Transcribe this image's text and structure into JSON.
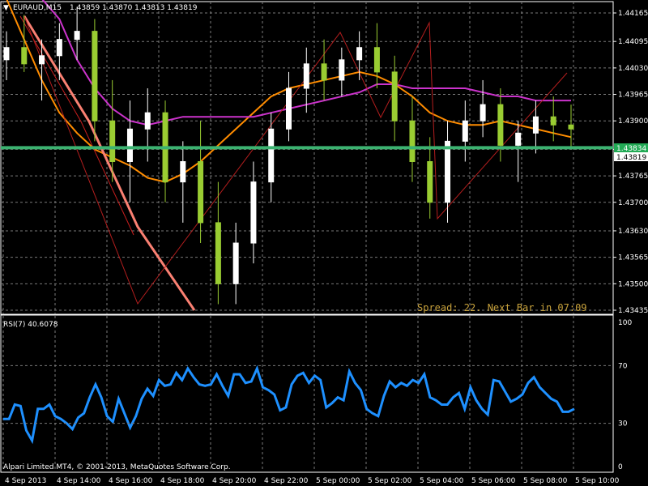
{
  "header": {
    "symbol": "EURAUD,M15",
    "ohlc": "1.43859 1.43870 1.43813 1.43819"
  },
  "spread_text": "Spread: 22. Next Bar in 07:09",
  "price_tags": {
    "bid": "1.43834",
    "last": "1.43819"
  },
  "copyright": "Alpari Limited MT4, © 2001-2013, MetaQuotes Software Corp.",
  "colors": {
    "bull": "#ffffff",
    "bear": "#9acd32",
    "bull_body": "#ffffff",
    "bear_body": "#9acd32",
    "grid": "#7a7a7a",
    "rsi": "#1e90ff",
    "ma_orange": "#ff8c00",
    "ma_magenta": "#cc33cc",
    "ma_salmon": "#fa8072",
    "ma_red": "#c81e1e",
    "zigzag": "#b41e1e",
    "spread_text": "#c8a23c",
    "hline": "#3cb371",
    "tag_bg": "#22aa55"
  },
  "chart_data": [
    {
      "type": "candlestick",
      "title": "EURAUD,M15",
      "ylim": [
        1.43435,
        1.44165
      ],
      "y_ticks": [
        "1.44165",
        "1.44095",
        "1.44030",
        "1.43965",
        "1.43900",
        "1.43830",
        "1.43765",
        "1.43700",
        "1.43630",
        "1.43565",
        "1.43500",
        "1.43435"
      ],
      "x_ticks": [
        "4 Sep 2013",
        "4 Sep 14:00",
        "4 Sep 16:00",
        "4 Sep 18:00",
        "4 Sep 20:00",
        "4 Sep 22:00",
        "5 Sep 00:00",
        "5 Sep 02:00",
        "5 Sep 04:00",
        "5 Sep 06:00",
        "5 Sep 08:00",
        "5 Sep 10:00"
      ],
      "horizontal_line": 1.43834,
      "candles": [
        {
          "o": 1.4405,
          "h": 1.4412,
          "l": 1.44,
          "c": 1.4408
        },
        {
          "o": 1.4408,
          "h": 1.4416,
          "l": 1.4402,
          "c": 1.4404
        },
        {
          "o": 1.4404,
          "h": 1.441,
          "l": 1.4395,
          "c": 1.4406
        },
        {
          "o": 1.4406,
          "h": 1.4414,
          "l": 1.44,
          "c": 1.441
        },
        {
          "o": 1.441,
          "h": 1.4418,
          "l": 1.4405,
          "c": 1.4412
        },
        {
          "o": 1.4412,
          "h": 1.4415,
          "l": 1.4385,
          "c": 1.439
        },
        {
          "o": 1.439,
          "h": 1.44,
          "l": 1.4375,
          "c": 1.438
        },
        {
          "o": 1.438,
          "h": 1.4395,
          "l": 1.437,
          "c": 1.4388
        },
        {
          "o": 1.4388,
          "h": 1.4398,
          "l": 1.438,
          "c": 1.4392
        },
        {
          "o": 1.4392,
          "h": 1.4395,
          "l": 1.437,
          "c": 1.4375
        },
        {
          "o": 1.4375,
          "h": 1.4385,
          "l": 1.4365,
          "c": 1.438
        },
        {
          "o": 1.438,
          "h": 1.439,
          "l": 1.436,
          "c": 1.4365
        },
        {
          "o": 1.4365,
          "h": 1.4375,
          "l": 1.4345,
          "c": 1.435
        },
        {
          "o": 1.435,
          "h": 1.4365,
          "l": 1.4345,
          "c": 1.436
        },
        {
          "o": 1.436,
          "h": 1.438,
          "l": 1.4355,
          "c": 1.4375
        },
        {
          "o": 1.4375,
          "h": 1.4392,
          "l": 1.437,
          "c": 1.4388
        },
        {
          "o": 1.4388,
          "h": 1.4402,
          "l": 1.4385,
          "c": 1.4398
        },
        {
          "o": 1.4398,
          "h": 1.4408,
          "l": 1.4392,
          "c": 1.4404
        },
        {
          "o": 1.4404,
          "h": 1.441,
          "l": 1.4395,
          "c": 1.44
        },
        {
          "o": 1.44,
          "h": 1.4408,
          "l": 1.4396,
          "c": 1.4405
        },
        {
          "o": 1.4405,
          "h": 1.4412,
          "l": 1.44,
          "c": 1.4408
        },
        {
          "o": 1.4408,
          "h": 1.4414,
          "l": 1.4398,
          "c": 1.4402
        },
        {
          "o": 1.4402,
          "h": 1.4406,
          "l": 1.4385,
          "c": 1.439
        },
        {
          "o": 1.439,
          "h": 1.4396,
          "l": 1.4375,
          "c": 1.438
        },
        {
          "o": 1.438,
          "h": 1.4386,
          "l": 1.4366,
          "c": 1.437
        },
        {
          "o": 1.437,
          "h": 1.439,
          "l": 1.4365,
          "c": 1.4385
        },
        {
          "o": 1.4385,
          "h": 1.4395,
          "l": 1.438,
          "c": 1.439
        },
        {
          "o": 1.439,
          "h": 1.44,
          "l": 1.4386,
          "c": 1.4394
        },
        {
          "o": 1.4394,
          "h": 1.4398,
          "l": 1.438,
          "c": 1.4384
        },
        {
          "o": 1.4384,
          "h": 1.439,
          "l": 1.4375,
          "c": 1.4387
        },
        {
          "o": 1.4387,
          "h": 1.4395,
          "l": 1.4382,
          "c": 1.4391
        },
        {
          "o": 1.4391,
          "h": 1.4396,
          "l": 1.4385,
          "c": 1.4389
        },
        {
          "o": 1.4389,
          "h": 1.4394,
          "l": 1.4383,
          "c": 1.4388
        }
      ],
      "series": [
        {
          "name": "MA orange",
          "values": [
            1.442,
            1.441,
            1.44,
            1.4392,
            1.4387,
            1.4383,
            1.4381,
            1.4379,
            1.4376,
            1.4375,
            1.4377,
            1.438,
            1.4384,
            1.4388,
            1.4392,
            1.4396,
            1.4398,
            1.4399,
            1.44,
            1.4401,
            1.4402,
            1.4401,
            1.4399,
            1.4396,
            1.4392,
            1.439,
            1.4389,
            1.4389,
            1.439,
            1.4389,
            1.4388,
            1.4387,
            1.4386
          ]
        },
        {
          "name": "MA magenta",
          "values": [
            1.443,
            1.4425,
            1.442,
            1.4415,
            1.4405,
            1.4398,
            1.4393,
            1.439,
            1.4389,
            1.439,
            1.4391,
            1.4391,
            1.4391,
            1.4391,
            1.4391,
            1.4392,
            1.4393,
            1.4394,
            1.4395,
            1.4396,
            1.4397,
            1.4399,
            1.4399,
            1.4398,
            1.4398,
            1.4398,
            1.4398,
            1.4397,
            1.4396,
            1.4396,
            1.4395,
            1.4395,
            1.4395
          ]
        }
      ]
    },
    {
      "type": "line",
      "title": "RSI(7) 40.6078",
      "ylim": [
        0,
        100
      ],
      "y_ticks": [
        "100",
        "70",
        "30",
        "0"
      ],
      "series": [
        {
          "name": "RSI(7)",
          "values": [
            33,
            33,
            43,
            42,
            25,
            18,
            40,
            40,
            43,
            35,
            33,
            30,
            26,
            34,
            37,
            48,
            57,
            48,
            35,
            31,
            47,
            37,
            27,
            35,
            47,
            54,
            49,
            60,
            56,
            57,
            65,
            60,
            68,
            62,
            57,
            56,
            57,
            64,
            56,
            49,
            64,
            64,
            58,
            59,
            68,
            55,
            53,
            50,
            39,
            41,
            57,
            63,
            65,
            58,
            63,
            60,
            41,
            44,
            48,
            46,
            66,
            58,
            53,
            40,
            37,
            35,
            49,
            59,
            55,
            58,
            56,
            60,
            58,
            64,
            48,
            46,
            43,
            43,
            48,
            51,
            40,
            55,
            46,
            40,
            36,
            60,
            59,
            52,
            45,
            47,
            50,
            58,
            62,
            55,
            51,
            47,
            45,
            38,
            38,
            40
          ]
        }
      ]
    }
  ]
}
